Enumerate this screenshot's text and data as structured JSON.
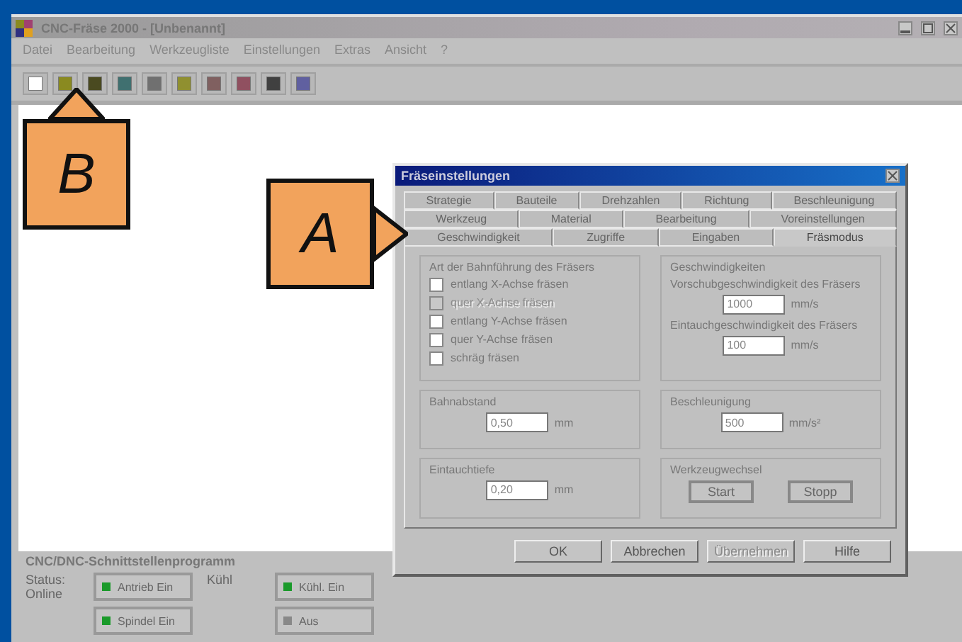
{
  "app": {
    "title": "CNC-Fräse 2000 - [Unbenannt]",
    "menu": [
      "Datei",
      "Bearbeitung",
      "Werkzeugliste",
      "Einstellungen",
      "Extras",
      "Ansicht",
      "?"
    ],
    "toolbar": [
      {
        "color": "#ffffff"
      },
      {
        "color": "#8a8a20"
      },
      {
        "color": "#4a4a20"
      },
      {
        "color": "#407070"
      },
      {
        "color": "#707070"
      },
      {
        "color": "#909030"
      },
      {
        "color": "#806060"
      },
      {
        "color": "#905060"
      },
      {
        "color": "#404040"
      },
      {
        "color": "#6060a0"
      }
    ]
  },
  "callouts": [
    {
      "label": "A",
      "kind": "right"
    },
    {
      "label": "B",
      "kind": "up"
    }
  ],
  "dialog": {
    "title": "Fräseinstellungen",
    "tab_rows": [
      [
        {
          "label": "Strategie",
          "selected": false
        },
        {
          "label": "Bauteile",
          "selected": false
        },
        {
          "label": "Drehzahlen",
          "selected": false
        },
        {
          "label": "Richtung",
          "selected": false
        },
        {
          "label": "Beschleunigung",
          "selected": false
        }
      ],
      [
        {
          "label": "Werkzeug",
          "selected": false
        },
        {
          "label": "Material",
          "selected": false
        },
        {
          "label": "Bearbeitung",
          "selected": false
        },
        {
          "label": "Voreinstellungen",
          "selected": false
        }
      ],
      [
        {
          "label": "Geschwindigkeit",
          "selected": false
        },
        {
          "label": "Zugriffe",
          "selected": false
        },
        {
          "label": "Eingaben",
          "selected": false
        },
        {
          "label": "Fräsmodus",
          "selected": true
        }
      ]
    ],
    "path_group": {
      "title": "Art der Bahnführung des Fräsers",
      "options": [
        {
          "label": "entlang X-Achse fräsen",
          "checked": false,
          "disabled": false
        },
        {
          "label": "quer X-Achse fräsen",
          "checked": false,
          "disabled": true
        },
        {
          "label": "entlang Y-Achse fräsen",
          "checked": false,
          "disabled": false
        },
        {
          "label": "quer Y-Achse fräsen",
          "checked": false,
          "disabled": false
        },
        {
          "label": "schräg fräsen",
          "checked": false,
          "disabled": false
        }
      ]
    },
    "speed_group": {
      "title": "Geschwindigkeiten",
      "fields": [
        {
          "label": "Vorschubgeschwindigkeit des Fräsers",
          "value": "1000",
          "unit": "mm/s"
        },
        {
          "label": "Eintauchgeschwindigkeit des Fräsers",
          "value": "100",
          "unit": "mm/s"
        }
      ]
    },
    "spacing_group": {
      "title": "Bahnabstand",
      "value": "0,50",
      "unit": "mm"
    },
    "accel_group": {
      "title": "Beschleunigung",
      "value": "500",
      "unit": "mm/s²"
    },
    "depth_group": {
      "title": "Eintauchtiefe",
      "value": "0,20",
      "unit": "mm"
    },
    "change_group": {
      "title": "Werkzeugwechsel",
      "buttons": [
        "Start",
        "Stopp"
      ]
    },
    "buttons": [
      {
        "label": "OK",
        "disabled": false
      },
      {
        "label": "Abbrechen",
        "disabled": false
      },
      {
        "label": "Übernehmen",
        "disabled": true
      },
      {
        "label": "Hilfe",
        "disabled": false
      }
    ]
  },
  "panel": {
    "title": "CNC/DNC-Schnittstellenprogramm",
    "status_label": "Status: Online",
    "left_buttons": [
      {
        "label": "Antrieb Ein",
        "on": true
      },
      {
        "label": "Spindel Ein",
        "on": true
      }
    ],
    "right_label": "Kühl",
    "right_buttons": [
      {
        "label": "Kühl. Ein",
        "on": true
      },
      {
        "label": "Aus",
        "on": false
      }
    ]
  }
}
